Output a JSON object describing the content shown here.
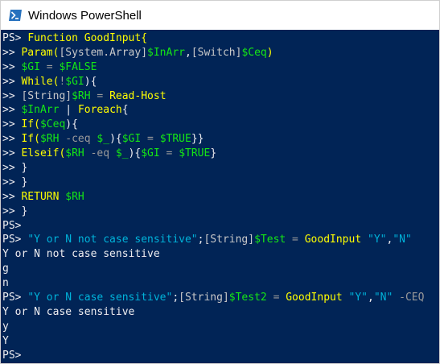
{
  "window": {
    "title": "Windows PowerShell",
    "icon": "powershell-icon",
    "colors": {
      "background": "#012456",
      "foreground": "#eeedf0",
      "command": "#ffff00",
      "variable": "#15e615",
      "string": "#01b3da",
      "operator": "#9a9a9a"
    }
  },
  "console": {
    "lines": [
      [
        {
          "t": "PS> ",
          "c": "prompt"
        },
        {
          "t": "Function GoodInput{",
          "c": "cmd"
        }
      ],
      [
        {
          "t": ">> ",
          "c": "prompt"
        },
        {
          "t": "Param(",
          "c": "cmd"
        },
        {
          "t": "[System.Array]",
          "c": "type"
        },
        {
          "t": "$InArr",
          "c": "var"
        },
        {
          "t": ",",
          "c": "plain"
        },
        {
          "t": "[Switch]",
          "c": "type"
        },
        {
          "t": "$Ceq",
          "c": "var"
        },
        {
          "t": ")",
          "c": "cmd"
        }
      ],
      [
        {
          "t": ">> ",
          "c": "prompt"
        },
        {
          "t": "$GI",
          "c": "var"
        },
        {
          "t": " = ",
          "c": "op"
        },
        {
          "t": "$FALSE",
          "c": "var"
        }
      ],
      [
        {
          "t": ">> ",
          "c": "prompt"
        },
        {
          "t": "While(",
          "c": "cmd"
        },
        {
          "t": "!",
          "c": "op"
        },
        {
          "t": "$GI",
          "c": "var"
        },
        {
          "t": "){",
          "c": "plain"
        }
      ],
      [
        {
          "t": ">> ",
          "c": "prompt"
        },
        {
          "t": "[String]",
          "c": "type"
        },
        {
          "t": "$RH",
          "c": "var"
        },
        {
          "t": " = ",
          "c": "op"
        },
        {
          "t": "Read-Host",
          "c": "cmd"
        }
      ],
      [
        {
          "t": ">> ",
          "c": "prompt"
        },
        {
          "t": "$InArr",
          "c": "var"
        },
        {
          "t": " | ",
          "c": "plain"
        },
        {
          "t": "Foreach",
          "c": "cmd"
        },
        {
          "t": "{",
          "c": "plain"
        }
      ],
      [
        {
          "t": ">> ",
          "c": "prompt"
        },
        {
          "t": "If(",
          "c": "cmd"
        },
        {
          "t": "$Ceq",
          "c": "var"
        },
        {
          "t": "){",
          "c": "plain"
        }
      ],
      [
        {
          "t": ">> ",
          "c": "prompt"
        },
        {
          "t": "If(",
          "c": "cmd"
        },
        {
          "t": "$RH",
          "c": "var"
        },
        {
          "t": " -ceq ",
          "c": "op"
        },
        {
          "t": "$_",
          "c": "var"
        },
        {
          "t": "){",
          "c": "plain"
        },
        {
          "t": "$GI",
          "c": "var"
        },
        {
          "t": " = ",
          "c": "op"
        },
        {
          "t": "$TRUE",
          "c": "var"
        },
        {
          "t": "}}",
          "c": "plain"
        }
      ],
      [
        {
          "t": ">> ",
          "c": "prompt"
        },
        {
          "t": "Elseif(",
          "c": "cmd"
        },
        {
          "t": "$RH",
          "c": "var"
        },
        {
          "t": " -eq ",
          "c": "op"
        },
        {
          "t": "$_",
          "c": "var"
        },
        {
          "t": "){",
          "c": "plain"
        },
        {
          "t": "$GI",
          "c": "var"
        },
        {
          "t": " = ",
          "c": "op"
        },
        {
          "t": "$TRUE",
          "c": "var"
        },
        {
          "t": "}",
          "c": "plain"
        }
      ],
      [
        {
          "t": ">> }",
          "c": "prompt"
        }
      ],
      [
        {
          "t": ">> }",
          "c": "prompt"
        }
      ],
      [
        {
          "t": ">> ",
          "c": "prompt"
        },
        {
          "t": "RETURN ",
          "c": "cmd"
        },
        {
          "t": "$RH",
          "c": "var"
        }
      ],
      [
        {
          "t": ">> }",
          "c": "prompt"
        }
      ],
      [
        {
          "t": "PS>",
          "c": "prompt"
        }
      ],
      [
        {
          "t": "PS> ",
          "c": "prompt"
        },
        {
          "t": "\"Y or N not case sensitive\"",
          "c": "str"
        },
        {
          "t": ";",
          "c": "plain"
        },
        {
          "t": "[String]",
          "c": "type"
        },
        {
          "t": "$Test",
          "c": "var"
        },
        {
          "t": " = ",
          "c": "op"
        },
        {
          "t": "GoodInput",
          "c": "cmd"
        },
        {
          "t": " \"Y\"",
          "c": "str"
        },
        {
          "t": ",",
          "c": "plain"
        },
        {
          "t": "\"N\"",
          "c": "str"
        }
      ],
      [
        {
          "t": "Y or N not case sensitive",
          "c": "plain"
        }
      ],
      [
        {
          "t": "g",
          "c": "plain"
        }
      ],
      [
        {
          "t": "n",
          "c": "plain"
        }
      ],
      [
        {
          "t": "PS> ",
          "c": "prompt"
        },
        {
          "t": "\"Y or N case sensitive\"",
          "c": "str"
        },
        {
          "t": ";",
          "c": "plain"
        },
        {
          "t": "[String]",
          "c": "type"
        },
        {
          "t": "$Test2",
          "c": "var"
        },
        {
          "t": " = ",
          "c": "op"
        },
        {
          "t": "GoodInput",
          "c": "cmd"
        },
        {
          "t": " \"Y\"",
          "c": "str"
        },
        {
          "t": ",",
          "c": "plain"
        },
        {
          "t": "\"N\"",
          "c": "str"
        },
        {
          "t": " -CEQ",
          "c": "op"
        }
      ],
      [
        {
          "t": "Y or N case sensitive",
          "c": "plain"
        }
      ],
      [
        {
          "t": "y",
          "c": "plain"
        }
      ],
      [
        {
          "t": "Y",
          "c": "plain"
        }
      ],
      [
        {
          "t": "PS>",
          "c": "prompt"
        }
      ]
    ]
  }
}
